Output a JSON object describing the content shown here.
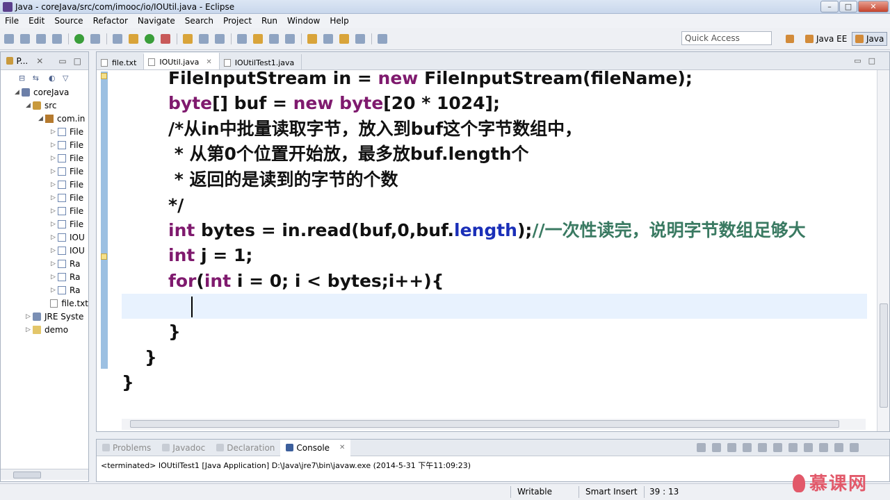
{
  "window": {
    "title": "Java - coreJava/src/com/imooc/io/IOUtil.java - Eclipse"
  },
  "menu": [
    "File",
    "Edit",
    "Source",
    "Refactor",
    "Navigate",
    "Search",
    "Project",
    "Run",
    "Window",
    "Help"
  ],
  "toolbar": {
    "quick_access": "Quick Access",
    "perspectives": [
      "Java EE",
      "Java"
    ]
  },
  "explorer": {
    "tab_label": "P...",
    "tree": [
      {
        "label": "coreJava",
        "icon": "project-icon"
      },
      {
        "label": "src",
        "icon": "source-folder-icon"
      },
      {
        "label": "com.in",
        "icon": "package-icon"
      },
      {
        "label": "File",
        "icon": "java-file-icon"
      },
      {
        "label": "File",
        "icon": "java-file-icon"
      },
      {
        "label": "File",
        "icon": "java-file-icon"
      },
      {
        "label": "File",
        "icon": "java-file-icon"
      },
      {
        "label": "File",
        "icon": "java-file-icon"
      },
      {
        "label": "File",
        "icon": "java-file-icon"
      },
      {
        "label": "File",
        "icon": "java-file-icon"
      },
      {
        "label": "File",
        "icon": "java-file-icon"
      },
      {
        "label": "IOU",
        "icon": "java-file-icon"
      },
      {
        "label": "IOU",
        "icon": "java-file-icon"
      },
      {
        "label": "Ra",
        "icon": "java-file-icon"
      },
      {
        "label": "Ra",
        "icon": "java-file-icon"
      },
      {
        "label": "Ra",
        "icon": "java-file-icon"
      },
      {
        "label": "file.txt",
        "icon": "text-file-icon"
      },
      {
        "label": "JRE Syste",
        "icon": "library-icon"
      },
      {
        "label": "demo",
        "icon": "folder-icon"
      }
    ]
  },
  "editor": {
    "tabs": [
      "file.txt",
      "IOUtil.java",
      "IOUtilTest1.java"
    ],
    "active_tab": "IOUtil.java",
    "code": {
      "l1": "FileInputStream in = new FileInputStream(fileName);",
      "l1_a": "FileInputStream in = ",
      "l1_kw": "new",
      "l1_b": " FileInputStream(fileName);",
      "l2_kw1": "byte",
      "l2_a": "[] buf = ",
      "l2_kw2": "new",
      "l2_sp": " ",
      "l2_kw3": "byte",
      "l2_b": "[20 * 1024];",
      "l3": "/*从in中批量读取字节，放入到buf这个字节数组中，",
      "l4": " * 从第0个位置开始放，最多放buf.length个",
      "l5": " * 返回的是读到的字节的个数",
      "l6": "*/",
      "l7_kw": "int",
      "l7_a": " bytes = in.read(buf,0,buf.",
      "l7_fld": "length",
      "l7_b": ");",
      "l7_cm": "//一次性读完，说明字节数组足够大",
      "l8_kw": "int",
      "l8_a": " j = 1;",
      "l9_kw1": "for",
      "l9_a": "(",
      "l9_kw2": "int",
      "l9_b": " i = 0; i < bytes;i++){",
      "l11": "}",
      "l12": "}",
      "l13": "}"
    }
  },
  "console": {
    "tabs": [
      "Problems",
      "Javadoc",
      "Declaration",
      "Console"
    ],
    "active_tab": "Console",
    "output": "<terminated> IOUtilTest1 [Java Application] D:\\Java\\jre7\\bin\\javaw.exe (2014-5-31 下午11:09:23)"
  },
  "status": {
    "writable": "Writable",
    "insert_mode": "Smart Insert",
    "position": "39 : 13"
  },
  "watermark": "慕课网",
  "colors": {
    "keyword": "#7F1A6E",
    "comment": "#3A7A62",
    "field": "#1A2FB8",
    "current_line": "#E8F2FE"
  }
}
